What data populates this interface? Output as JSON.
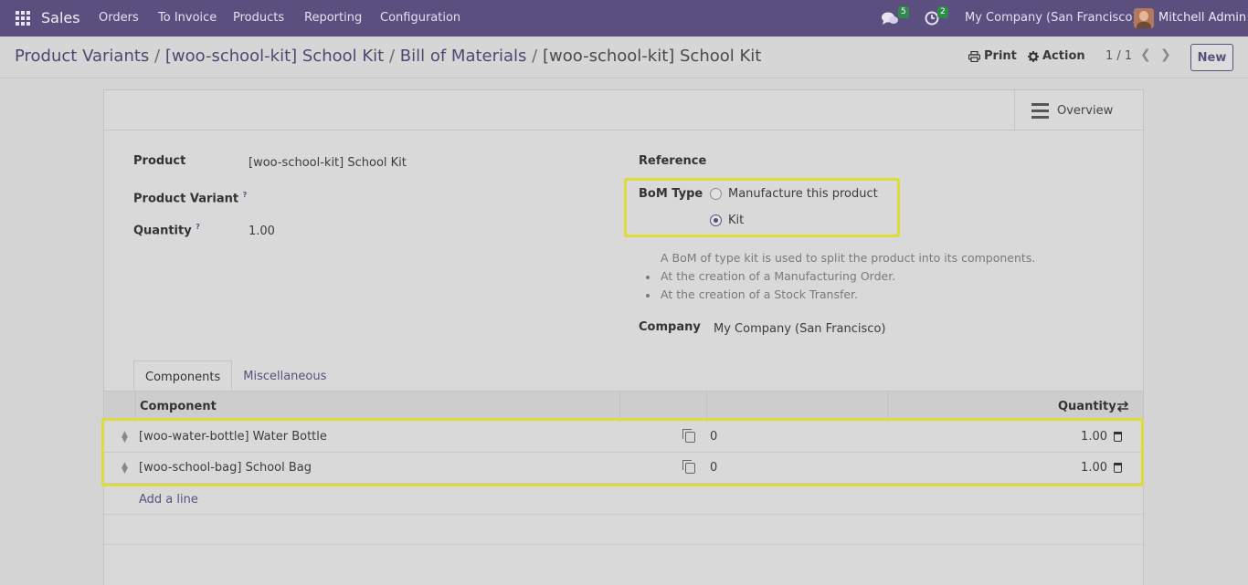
{
  "navbar": {
    "brand": "Sales",
    "menu": [
      "Orders",
      "To Invoice",
      "Products",
      "Reporting",
      "Configuration"
    ],
    "messages_count": "5",
    "activities_count": "2",
    "company": "My Company (San Francisco)",
    "user": "Mitchell Admin"
  },
  "breadcrumb": {
    "items": [
      "Product Variants",
      "[woo-school-kit] School Kit",
      "Bill of Materials"
    ],
    "separator": "/",
    "current": "[woo-school-kit] School Kit"
  },
  "control_panel": {
    "print_label": "Print",
    "action_label": "Action",
    "pager": "1 / 1",
    "new_label": "New"
  },
  "button_box": {
    "overview_label": "Overview"
  },
  "form": {
    "product_label": "Product",
    "product_value": "[woo-school-kit] School Kit",
    "variant_label": "Product Variant",
    "quantity_label": "Quantity",
    "quantity_value": "1.00",
    "reference_label": "Reference",
    "bom_type_label": "BoM Type",
    "bom_type_options": [
      "Manufacture this product",
      "Kit"
    ],
    "bom_type_selected": "Kit",
    "help_intro": "A BoM of type kit is used to split the product into its components.",
    "help_points": [
      "At the creation of a Manufacturing Order.",
      "At the creation of a Stock Transfer."
    ],
    "company_label": "Company",
    "company_value": "My Company (San Francisco)",
    "help_marker": "?"
  },
  "tabs": [
    "Components",
    "Miscellaneous"
  ],
  "components_table": {
    "headers": {
      "component": "Component",
      "quantity": "Quantity"
    },
    "rows": [
      {
        "component": "[woo-water-bottle] Water Bottle",
        "value": "0",
        "quantity": "1.00"
      },
      {
        "component": "[woo-school-bag] School Bag",
        "value": "0",
        "quantity": "1.00"
      }
    ],
    "add_line_label": "Add a line"
  },
  "colors": {
    "navbar": "#5b4f7f",
    "accent": "#5b4f7f",
    "highlight": "#dcdc3a"
  }
}
